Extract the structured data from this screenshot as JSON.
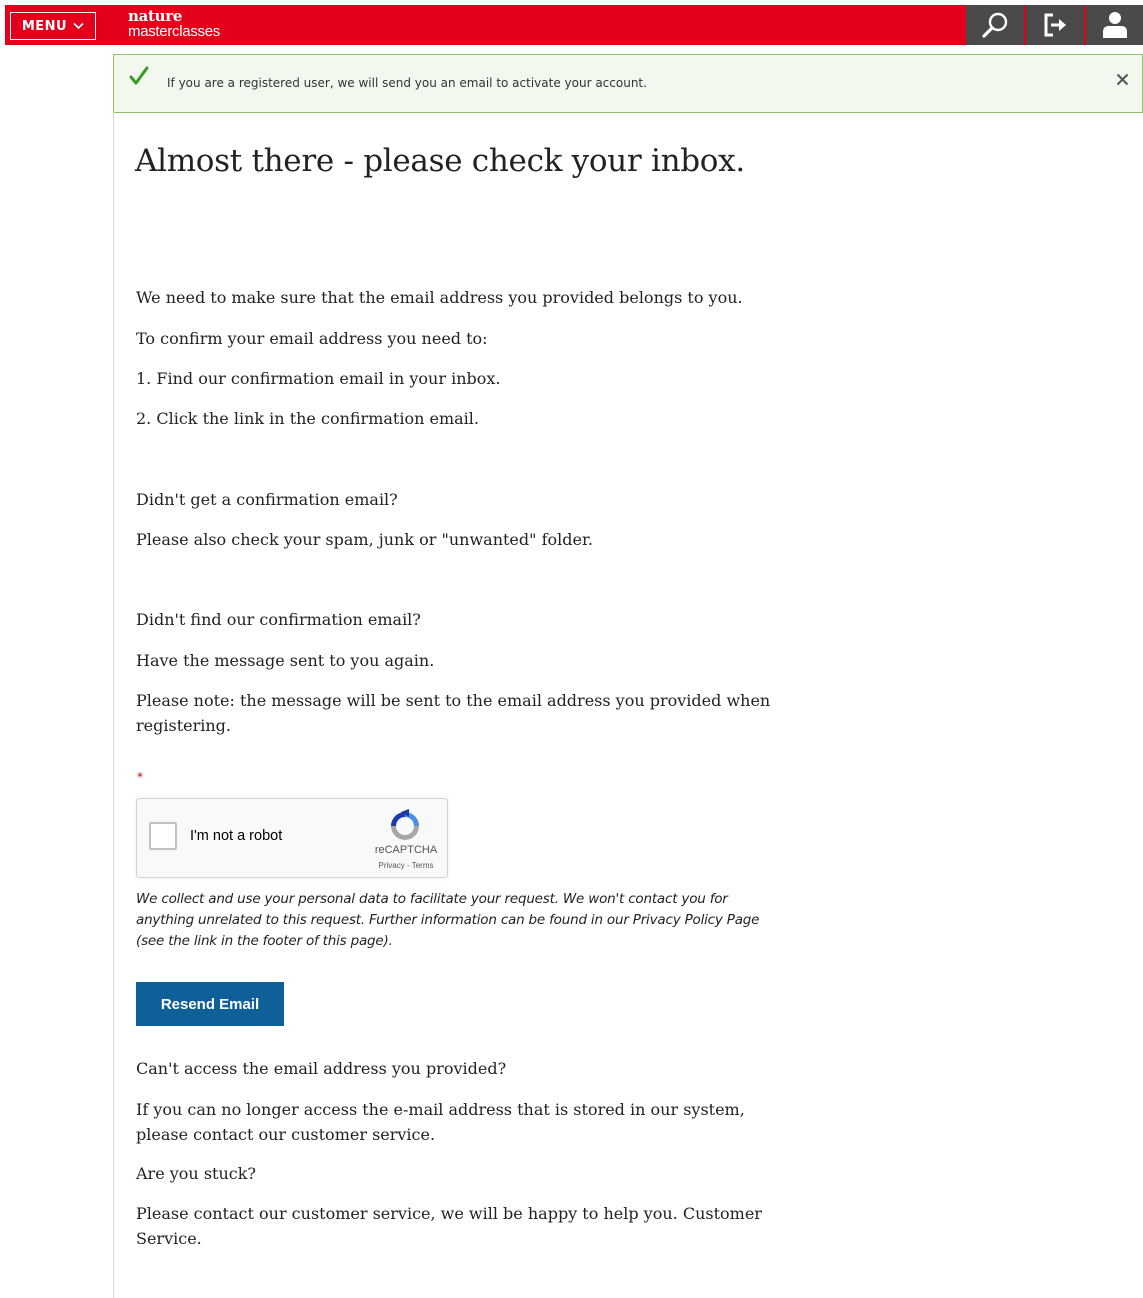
{
  "header": {
    "menu_label": "MENU",
    "brand_line1": "nature",
    "brand_line2": "masterclasses",
    "icons": [
      "search-icon",
      "logout-icon",
      "user-icon"
    ],
    "brand_color": "#e3001b"
  },
  "notice": {
    "message": "If you are a registered user, we will send you an email to activate your account."
  },
  "main": {
    "title": "Almost there - please check your inbox.",
    "p1": "We need to make sure that the email address you provided belongs to you.",
    "p2": "To confirm your email address you need to:",
    "p3": "1. Find our confirmation email in your inbox.",
    "p4": "2. Click the link in the confirmation email.",
    "p5": "Didn't get a confirmation email?",
    "p6": "Please also check your spam, junk or \"unwanted\" folder.",
    "p7": "Didn't find our confirmation email?",
    "p8": "Have the message sent to you again.",
    "p9": "Please note: the message will be sent to the email address you provided when registering.",
    "asterisk": "*",
    "captcha_label": "I'm not a robot",
    "captcha_brand": "reCAPTCHA",
    "captcha_links": "Privacy - Terms",
    "privacy_note": "We collect and use your personal data to facilitate your request. We won't contact you for anything unrelated to this request. Further information can be found in our Privacy Policy Page (see the link in the footer of this page).",
    "resend_label": "Resend Email",
    "p10": "Can't access the email address you provided?",
    "p11": "If you can no longer access the e-mail address that is stored in our system, please contact our customer service.",
    "p12": "Are you stuck?",
    "p13": "Please contact our customer service, we will be happy to help you. Customer Service.",
    "button_color": "#0f5f99"
  }
}
